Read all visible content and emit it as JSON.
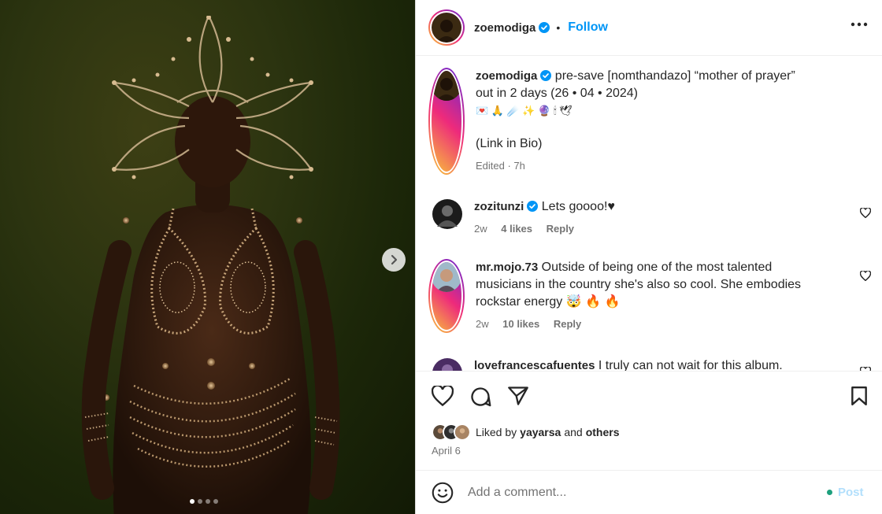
{
  "post": {
    "username": "zoemodiga",
    "follow_label": "Follow",
    "separator": "•",
    "caption_line1": "pre-save [nomthandazo] “mother of prayer”",
    "caption_line2": "out in 2 days (26 • 04 • 2024)",
    "caption_emoji": "💌 🙏 ☄️ ✨ 🔮 🕯 🕊",
    "caption_link": "(Link in Bio)",
    "edited": "Edited · 7h"
  },
  "comments": [
    {
      "username": "zozitunzi",
      "text": "Lets goooo!♥",
      "time": "2w",
      "likes": "4 likes",
      "reply": "Reply"
    },
    {
      "username": "mr.mojo.73",
      "text_line1": "Outside of being one of the most talented",
      "text_line2": "musicians in the country she's also so cool. She embodies",
      "text_line3": "rockstar energy 🤯 🔥 🔥",
      "time": "2w",
      "likes": "10 likes",
      "reply": "Reply"
    },
    {
      "username": "lovefrancescafuentes",
      "text": "I truly can not wait for this album."
    }
  ],
  "engagement": {
    "liked_prefix": "Liked by",
    "liked_user": "yayarsa",
    "liked_and": "and",
    "liked_others": "others",
    "date": "April 6"
  },
  "comment_box": {
    "placeholder": "Add a comment...",
    "post_label": "Post"
  },
  "colors": {
    "accent": "#0095f6",
    "verified": "#0095f6",
    "muted": "#737373",
    "post_disabled": "#b2dffc"
  },
  "carousel": {
    "slides": 4,
    "active": 1
  }
}
